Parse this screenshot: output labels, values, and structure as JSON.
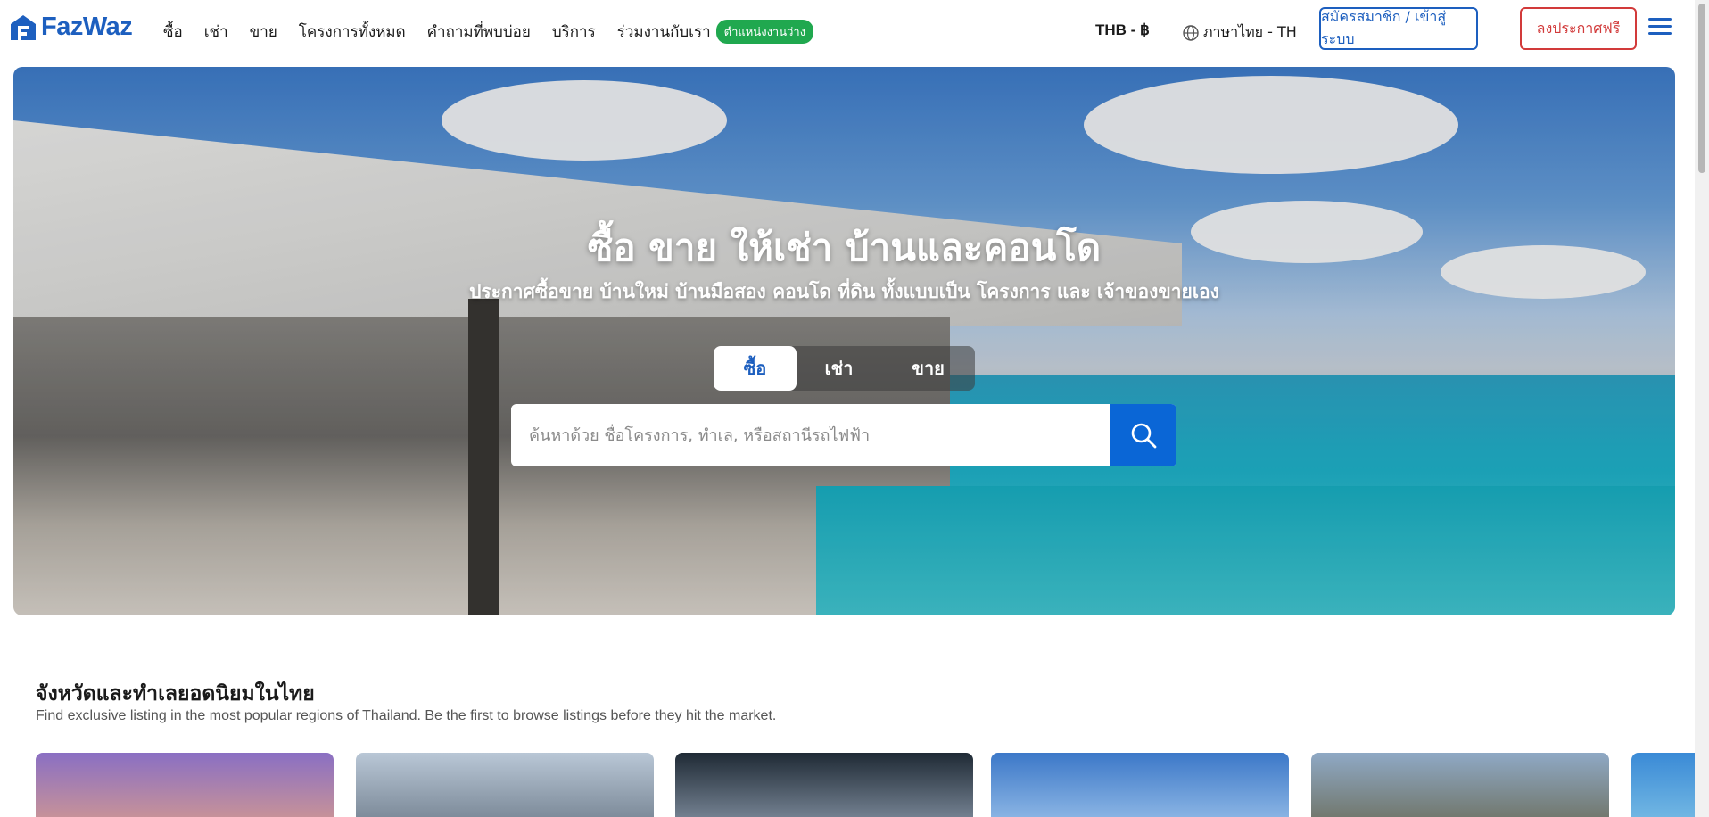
{
  "header": {
    "logo_text": "FazWaz",
    "nav": [
      "ซื้อ",
      "เช่า",
      "ขาย",
      "โครงการทั้งหมด",
      "คำถามที่พบบ่อย",
      "บริการ",
      "ร่วมงานกับเรา"
    ],
    "nav_badge": "ตำแหน่งงานว่าง",
    "currency": "THB - ฿",
    "language": "ภาษาไทย - TH",
    "login_label": "สมัครสมาชิก / เข้าสู่ระบบ",
    "post_label": "ลงประกาศฟรี",
    "brand_color": "#1d5fbf",
    "post_color": "#d23a3a",
    "badge_color": "#20a84f"
  },
  "hero": {
    "title": "ซื้อ ขาย ให้เช่า บ้านและคอนโด",
    "subtitle": "ประกาศซื้อขาย บ้านใหม่ บ้านมือสอง คอนโด ที่ดิน ทั้งแบบเป็น โครงการ และ เจ้าของขายเอง",
    "tabs": [
      "ซื้อ",
      "เช่า",
      "ขาย"
    ],
    "active_tab": "ซื้อ",
    "search_placeholder": "ค้นหาด้วย ชื่อโครงการ, ทำเล, หรือสถานีรถไฟฟ้า",
    "search_icon": "search-icon"
  },
  "section": {
    "title": "จังหวัดและทำเลยอดนิยมในไทย",
    "subtitle": "Find exclusive listing in the most popular regions of Thailand. Be the first to browse listings before they hit the market."
  }
}
